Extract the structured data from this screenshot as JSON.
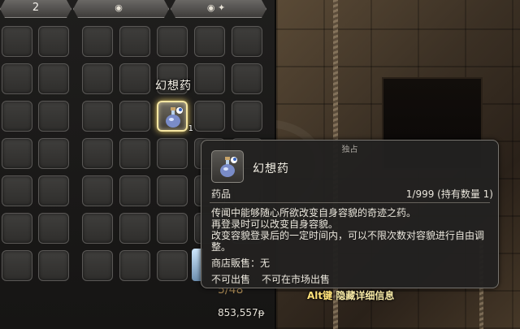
{
  "inventory": {
    "tabs": [
      {
        "label": "2",
        "icon": ""
      },
      {
        "label": "",
        "icon": "bag-icon"
      },
      {
        "label": "",
        "icon": "bag-sparkle-icon"
      }
    ],
    "hover_name": "幻想药",
    "selected_item_qty": "1",
    "gil": "853,557",
    "gil_symbol": "ᵽ",
    "gil_partial": "5/48"
  },
  "tooltip": {
    "unique": "独占",
    "name": "幻想药",
    "icon": "fantasia-potion-icon",
    "category": "药品",
    "count": "1/999 (持有数量 1)",
    "description": [
      "传闻中能够随心所欲改变自身容貌的奇迹之药。",
      "再登录时可以改变自身容貌。",
      "改变容貌登录后的一定时间内，可以不限次数对容貌进行自由调",
      "整。"
    ],
    "shop_label": "商店販售：无",
    "flags": [
      "不可出售",
      "不可在市场出售"
    ]
  },
  "hint": {
    "key": "Alt键",
    "text": " 隐藏详细信息"
  },
  "colors": {
    "selected_glow": "#f3d66e",
    "hint_text": "#f6e9a6"
  }
}
